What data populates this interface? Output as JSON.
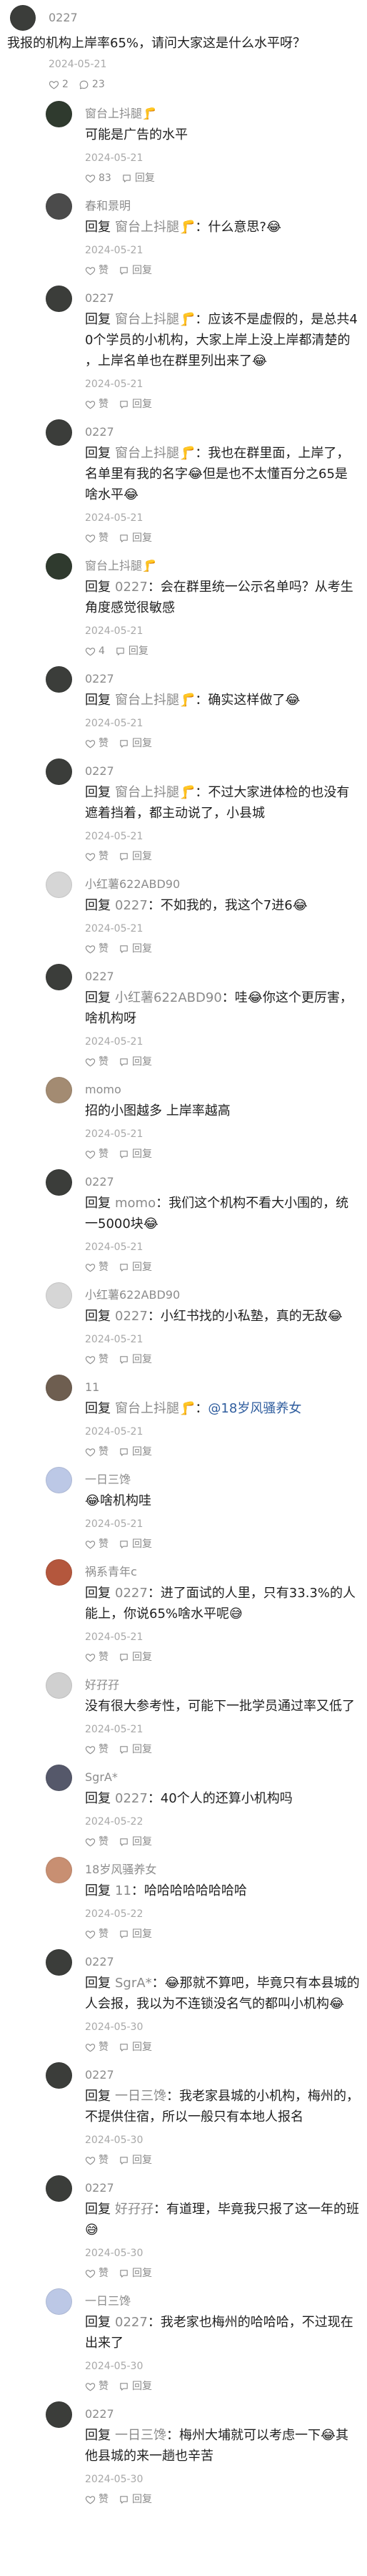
{
  "ui": {
    "reply_prefix": "回复",
    "reply_label": "回复"
  },
  "post": {
    "user": "0227",
    "avatar_color": "#3b3d3a",
    "text": "我报的机构上岸率65%，请问大家这是什么水平呀？",
    "date": "2024-05-21",
    "likes": "2",
    "comments": "23"
  },
  "comments": [
    {
      "user": "窗台上抖腿🦵",
      "avatar_color": "#2f3a2e",
      "text": "可能是广告的水平",
      "date": "2024-05-21",
      "likes": "83"
    },
    {
      "user": "春和景明",
      "avatar_color": "#4b4b4b",
      "reply_to": "窗台上抖腿🦵",
      "text": "：什么意思?😂",
      "date": "2024-05-21",
      "likes": "赞"
    },
    {
      "user": "0227",
      "avatar_color": "#3b3d3a",
      "reply_to": "窗台上抖腿🦵",
      "text": "：应该不是虚假的，是总共40个学员的小机构，大家上岸上没上岸都清楚的，上岸名单也在群里列出来了😂",
      "date": "2024-05-21",
      "likes": "赞"
    },
    {
      "user": "0227",
      "avatar_color": "#3b3d3a",
      "reply_to": "窗台上抖腿🦵",
      "text": "：我也在群里面，上岸了，名单里有我的名字😂但是也不太懂百分之65是啥水平😂",
      "date": "2024-05-21",
      "likes": "赞"
    },
    {
      "user": "窗台上抖腿🦵",
      "avatar_color": "#2f3a2e",
      "reply_to": "0227",
      "text": "：会在群里统一公示名单吗？从考生角度感觉很敏感",
      "date": "2024-05-21",
      "likes": "4"
    },
    {
      "user": "0227",
      "avatar_color": "#3b3d3a",
      "reply_to": "窗台上抖腿🦵",
      "text": "：确实这样做了😂",
      "date": "2024-05-21",
      "likes": "赞"
    },
    {
      "user": "0227",
      "avatar_color": "#3b3d3a",
      "reply_to": "窗台上抖腿🦵",
      "text": "：不过大家进体检的也没有遮着挡着，都主动说了，小县城",
      "date": "2024-05-21",
      "likes": "赞"
    },
    {
      "user": "小红薯622ABD90",
      "avatar_color": "#d6d6d6",
      "reply_to": "0227",
      "text": "：不如我的，我这个7进6😂",
      "date": "2024-05-21",
      "likes": "赞"
    },
    {
      "user": "0227",
      "avatar_color": "#3b3d3a",
      "reply_to": "小红薯622ABD90",
      "text": "：哇😂你这个更厉害，啥机构呀",
      "date": "2024-05-21",
      "likes": "赞"
    },
    {
      "user": "momo",
      "avatar_color": "#a38b72",
      "text": "招的小图越多 上岸率越高",
      "date": "2024-05-21",
      "likes": "赞"
    },
    {
      "user": "0227",
      "avatar_color": "#3b3d3a",
      "reply_to": "momo",
      "text": "：我们这个机构不看大小围的，统一5000块😂",
      "date": "2024-05-21",
      "likes": "赞"
    },
    {
      "user": "小红薯622ABD90",
      "avatar_color": "#d6d6d6",
      "reply_to": "0227",
      "text": "：小红书找的小私塾，真的无敌😂",
      "date": "2024-05-21",
      "likes": "赞"
    },
    {
      "user": "11",
      "avatar_color": "#6e5e50",
      "reply_to": "窗台上抖腿🦵",
      "text": "：",
      "mention": "@18岁风骚养女",
      "date": "2024-05-21",
      "likes": "赞"
    },
    {
      "user": "一日三馋",
      "avatar_color": "#bcc8e6",
      "text": "😂啥机构哇",
      "date": "2024-05-21",
      "likes": "赞"
    },
    {
      "user": "祸系青年c",
      "avatar_color": "#b4573d",
      "reply_to": "0227",
      "text": "：进了面试的人里，只有33.3%的人能上，你说65%啥水平呢😅",
      "date": "2024-05-21",
      "likes": "赞"
    },
    {
      "user": "好孖孖",
      "avatar_color": "#d0d0d0",
      "text": "没有很大参考性，可能下一批学员通过率又低了",
      "date": "2024-05-21",
      "likes": "赞"
    },
    {
      "user": "SgrA*",
      "avatar_color": "#55586a",
      "reply_to": "0227",
      "text": "：40个人的还算小机构吗",
      "date": "2024-05-22",
      "likes": "赞"
    },
    {
      "user": "18岁风骚养女",
      "avatar_color": "#c88f72",
      "reply_to": "11",
      "text": "：哈哈哈哈哈哈哈哈",
      "date": "2024-05-22",
      "likes": "赞"
    },
    {
      "user": "0227",
      "avatar_color": "#3b3d3a",
      "reply_to": "SgrA*",
      "text": "：😂那就不算吧，毕竟只有本县城的人会报，我以为不连锁没名气的都叫小机构😂",
      "date": "2024-05-30",
      "likes": "赞"
    },
    {
      "user": "0227",
      "avatar_color": "#3b3d3a",
      "reply_to": "一日三馋",
      "text": "：我老家县城的小机构，梅州的，不提供住宿，所以一般只有本地人报名",
      "date": "2024-05-30",
      "likes": "赞"
    },
    {
      "user": "0227",
      "avatar_color": "#3b3d3a",
      "reply_to": "好孖孖",
      "text": "：有道理，毕竟我只报了这一年的班😅",
      "date": "2024-05-30",
      "likes": "赞"
    },
    {
      "user": "一日三馋",
      "avatar_color": "#bcc8e6",
      "reply_to": "0227",
      "text": "：我老家也梅州的哈哈哈，不过现在出来了",
      "date": "2024-05-30",
      "likes": "赞"
    },
    {
      "user": "0227",
      "avatar_color": "#3b3d3a",
      "reply_to": "一日三馋",
      "text": "：梅州大埔就可以考虑一下😂其他县城的来一趟也辛苦",
      "date": "2024-05-30",
      "likes": "赞"
    }
  ]
}
